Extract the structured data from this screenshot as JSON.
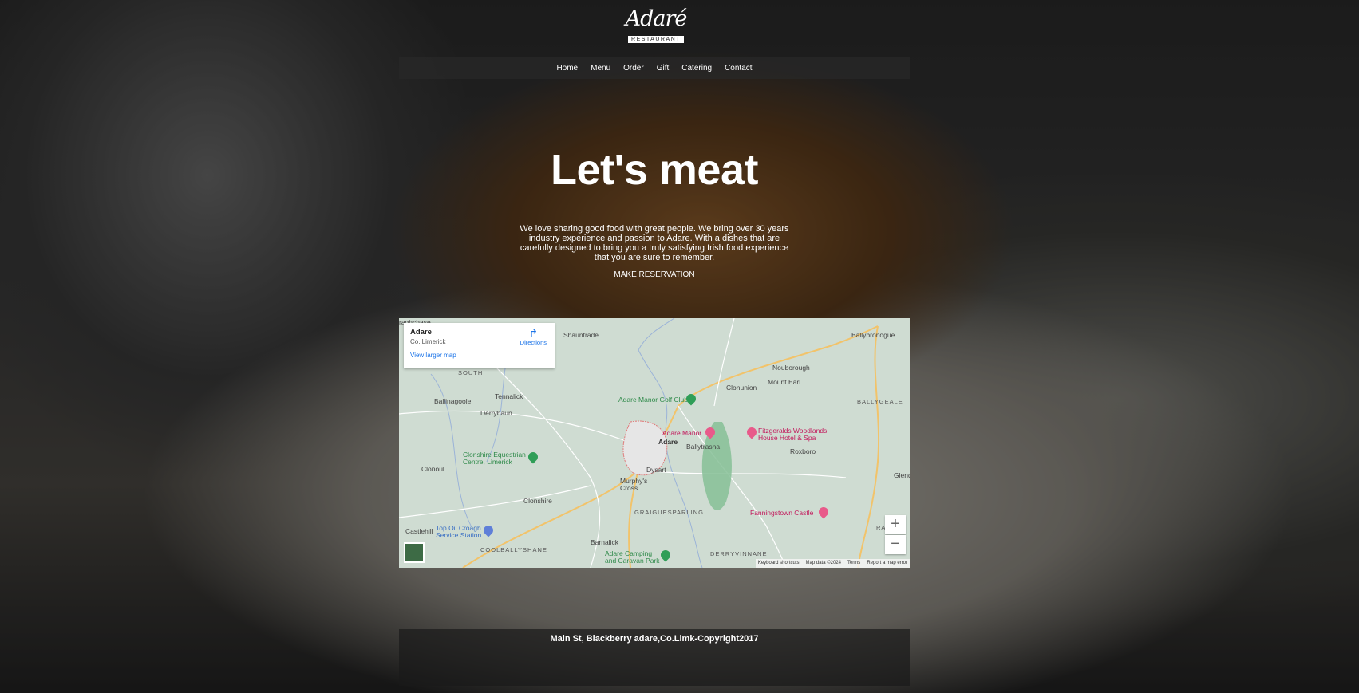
{
  "logo": {
    "script": "Adaré",
    "sub": "RESTAURANT"
  },
  "nav": {
    "items": [
      "Home",
      "Menu",
      "Order",
      "Gift",
      "Catering",
      "Contact"
    ]
  },
  "hero": {
    "title": "Let's meat",
    "text": "We love sharing good food with great people. We bring over 30 years industry experience and passion to Adare. With a dishes that are carefully designed to bring you a truly satisfying Irish food experience that you are sure to remember.",
    "cta": "MAKE RESERVATION"
  },
  "map": {
    "card": {
      "name": "Adare",
      "sub": "Co. Limerick",
      "larger": "View larger map",
      "directions": "Directions"
    },
    "zoom_in": "+",
    "zoom_out": "−",
    "labels": {
      "raghchase": "raghchase",
      "shauntrade": "Shauntrade",
      "ballybronogue": "Ballybronogue",
      "nouborough": "Nouborough",
      "south": "SOUTH",
      "clonunion": "Clonunion",
      "mount_earl": "Mount Earl",
      "tennalick": "Tennalick",
      "ballinagoole": "Ballinagoole",
      "golf": "Adare Manor Golf Club",
      "ballygeale": "BALLYGEALE",
      "derrybaun": "Derrybaun",
      "adare_manor": "Adare Manor",
      "fitzgeralds": "Fitzgeralds Woodlands House Hotel & Spa",
      "adare": "Adare",
      "ballytrasna": "Ballytrasna",
      "roxboro": "Roxboro",
      "clonshire_eq": "Clonshire Equestrian Centre, Limerick",
      "clonoul": "Clonoul",
      "dysart": "Dysart",
      "glend": "Glend",
      "murphys": "Murphy's Cross",
      "clonshire": "Clonshire",
      "graigues": "GRAIGUESPARLING",
      "fanningstown": "Fanningstown Castle",
      "castlehill": "Castlehill",
      "topoil": "Top Oil Croagh Service Station",
      "coolbally": "COOLBALLYSHANE",
      "barnalick": "Barnalick",
      "caravan": "Adare Camping and Caravan Park",
      "derryvinnane": "DERRYVINNANE",
      "ra": "RA"
    },
    "attribution": [
      "Keyboard shortcuts",
      "Map data ©2024",
      "Terms",
      "Report a map error"
    ]
  },
  "footer": {
    "text": "Main St, Blackberry adare,Co.Limk-Copyright2017"
  },
  "colors": {
    "nav_bg": "#282828",
    "map_bg": "#cfdcd2",
    "link": "#1a73e8",
    "poi_green": "#2f9e57",
    "poi_pink": "#e85a8a"
  }
}
